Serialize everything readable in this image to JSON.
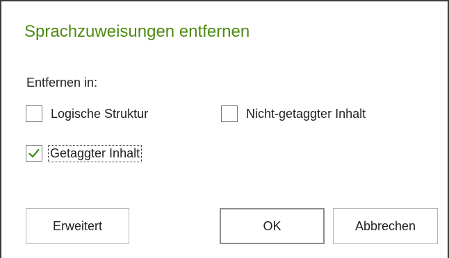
{
  "dialog": {
    "title": "Sprachzuweisungen entfernen",
    "section_label": "Entfernen in:",
    "options": {
      "logical_structure": {
        "label": "Logische Struktur",
        "checked": false
      },
      "untagged_content": {
        "label": "Nicht-getaggter Inhalt",
        "checked": false
      },
      "tagged_content": {
        "label": "Getaggter Inhalt",
        "checked": true
      }
    },
    "buttons": {
      "advanced": "Erweitert",
      "ok": "OK",
      "cancel": "Abbrechen"
    }
  },
  "colors": {
    "title": "#4e8a12",
    "checkmark": "#3c8a12"
  }
}
